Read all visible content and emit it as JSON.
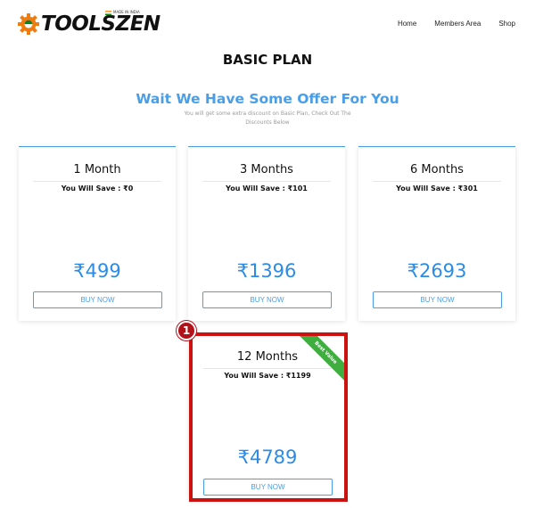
{
  "header": {
    "logo_text": "TOOLSZEN",
    "logo_tagline": "MADE IN INDIA",
    "nav": [
      "Home",
      "Members Area",
      "Shop"
    ]
  },
  "page": {
    "title": "BASIC PLAN",
    "offer_title": "Wait We Have Some Offer For You",
    "offer_subtitle": "You will get some extra discount on Basic Plan, Check Out The Discounts Below"
  },
  "plans": [
    {
      "months": "1 Month",
      "save": "You Will Save : ₹0",
      "price": "₹499",
      "buy": "BUY NOW"
    },
    {
      "months": "3 Months",
      "save": "You Will Save : ₹101",
      "price": "₹1396",
      "buy": "BUY NOW"
    },
    {
      "months": "6 Months",
      "save": "You Will Save : ₹301",
      "price": "₹2693",
      "buy": "BUY NOW"
    },
    {
      "months": "12 Months",
      "save": "You Will Save : ₹1199",
      "price": "₹4789",
      "buy": "BUY NOW",
      "ribbon": "Best Value"
    }
  ],
  "annotation": {
    "marker": "1"
  },
  "colors": {
    "accent": "#4a9ee8",
    "price": "#2b8be6",
    "ribbon": "#3fae3f",
    "highlight": "#cc1111"
  },
  "icons": {
    "logo": "gear-icon"
  }
}
